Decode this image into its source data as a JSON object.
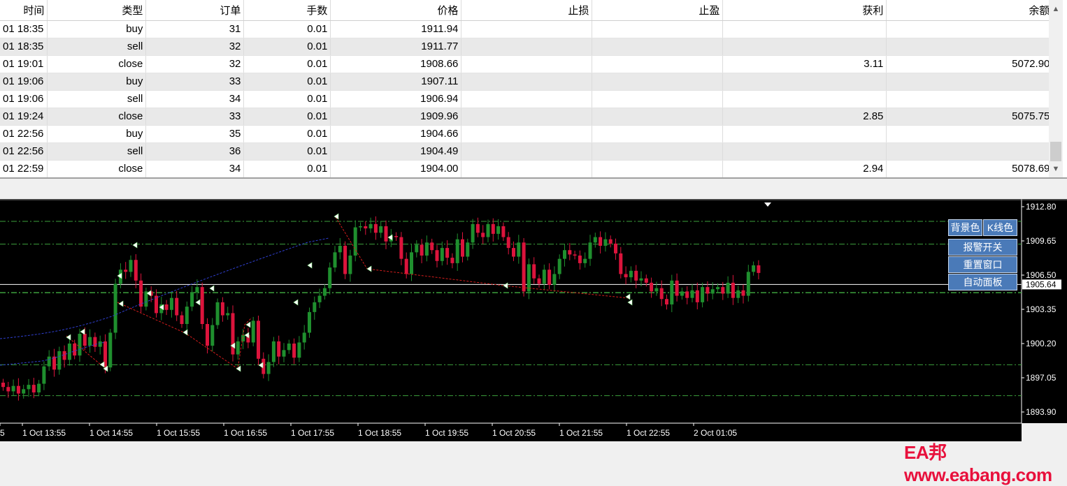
{
  "table": {
    "columns": [
      "时间",
      "类型",
      "订单",
      "手数",
      "价格",
      "止损",
      "止盈",
      "获利",
      "余额"
    ],
    "rows": [
      [
        "01 18:35",
        "buy",
        "31",
        "0.01",
        "1911.94",
        "",
        "",
        "",
        ""
      ],
      [
        "01 18:35",
        "sell",
        "32",
        "0.01",
        "1911.77",
        "",
        "",
        "",
        ""
      ],
      [
        "01 19:01",
        "close",
        "32",
        "0.01",
        "1908.66",
        "",
        "",
        "3.11",
        "5072.90"
      ],
      [
        "01 19:06",
        "buy",
        "33",
        "0.01",
        "1907.11",
        "",
        "",
        "",
        ""
      ],
      [
        "01 19:06",
        "sell",
        "34",
        "0.01",
        "1906.94",
        "",
        "",
        "",
        ""
      ],
      [
        "01 19:24",
        "close",
        "33",
        "0.01",
        "1909.96",
        "",
        "",
        "2.85",
        "5075.75"
      ],
      [
        "01 22:56",
        "buy",
        "35",
        "0.01",
        "1904.66",
        "",
        "",
        "",
        ""
      ],
      [
        "01 22:56",
        "sell",
        "36",
        "0.01",
        "1904.49",
        "",
        "",
        "",
        ""
      ],
      [
        "01 22:59",
        "close",
        "34",
        "0.01",
        "1904.00",
        "",
        "",
        "2.94",
        "5078.69"
      ]
    ]
  },
  "chart": {
    "price_axis": [
      "1912.80",
      "1909.65",
      "1906.50",
      "1903.35",
      "1900.20",
      "1897.05",
      "1893.90"
    ],
    "time_axis": [
      "5",
      "1 Oct 13:55",
      "1 Oct 14:55",
      "1 Oct 15:55",
      "1 Oct 16:55",
      "1 Oct 17:55",
      "1 Oct 18:55",
      "1 Oct 19:55",
      "1 Oct 20:55",
      "1 Oct 21:55",
      "1 Oct 22:55",
      "2 Oct 01:05"
    ],
    "current_price": "1905.64",
    "price_min": 1893.9,
    "price_max": 1912.8,
    "colors": {
      "background": "#000000",
      "bull": "#1f8f2e",
      "bear": "#dc143c",
      "grid_level": "#3ca03c",
      "ma_line": "#2f3fd0",
      "zigzag": "#d41c1c",
      "axis_text": "#ffffff"
    },
    "buttons": {
      "bg_color": "背景色",
      "k_color": "K线色",
      "alarm": "报警开关",
      "reset": "重置窗口",
      "auto_panel": "自动面板"
    }
  },
  "watermark": "EA邦www.eabang.com"
}
